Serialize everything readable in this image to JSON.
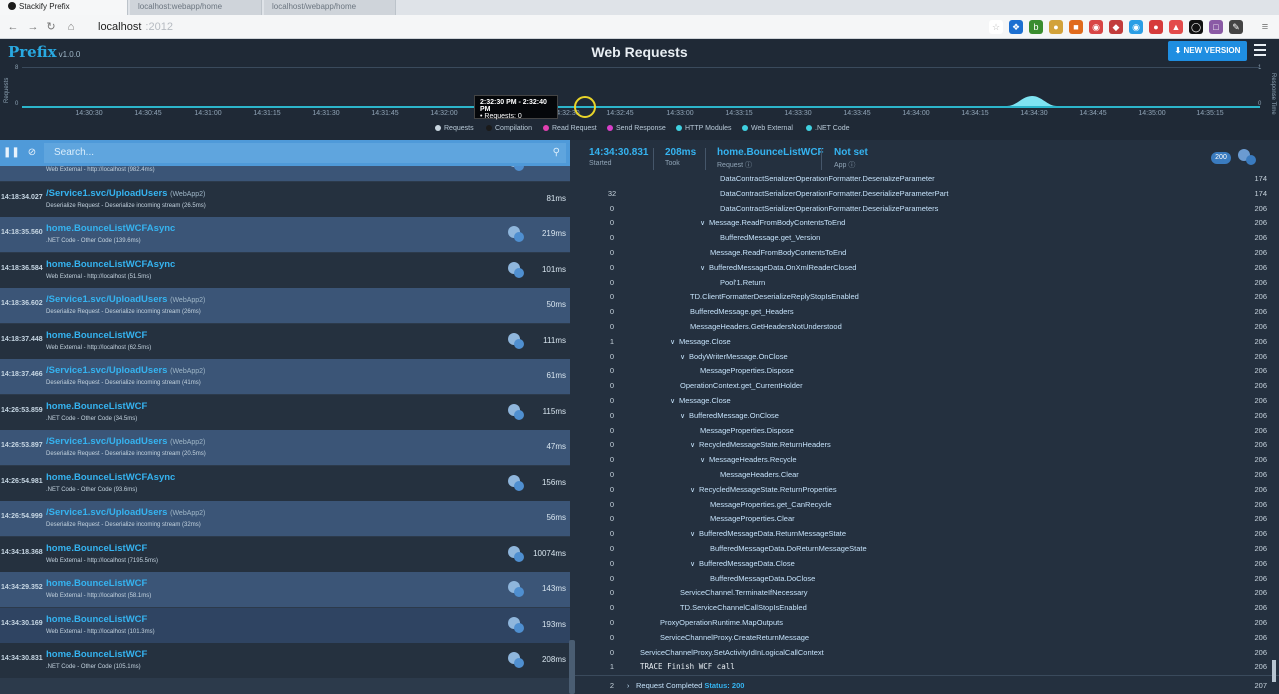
{
  "browser": {
    "tabs": [
      {
        "label": "Stackify Prefix",
        "active": true
      },
      {
        "label": "localhost:webapp/home",
        "active": false
      },
      {
        "label": "localhost/webapp/home",
        "active": false
      }
    ],
    "url": "localhost",
    "url_ghost": ":2012"
  },
  "app": {
    "logo": "Prefix",
    "version": "v1.0.0",
    "title": "Web Requests",
    "new_version_label": "NEW VERSION"
  },
  "timeline": {
    "left_axis_label": "Requests",
    "right_axis_label": "Response Time",
    "top_value": "8",
    "bottom_value": "0",
    "right_top": "1",
    "right_bottom": "0",
    "ticks": [
      "14:30:30",
      "14:30:45",
      "14:31:00",
      "14:31:15",
      "14:31:30",
      "14:31:45",
      "14:32:00",
      "14:32:30",
      "14:32:45",
      "14:33:00",
      "14:33:15",
      "14:33:30",
      "14:33:45",
      "14:34:00",
      "14:34:15",
      "14:34:30",
      "14:34:45",
      "14:35:00",
      "14:35:15"
    ],
    "tooltip_range": "2:32:30 PM - 2:32:40 PM",
    "tooltip_value": "• Requests: 0",
    "legend": [
      {
        "label": "Requests",
        "color": "#c9d6e0"
      },
      {
        "label": "Compilation",
        "color": "#1a1a1a"
      },
      {
        "label": "Read Request",
        "color": "#e040b0"
      },
      {
        "label": "Send Response",
        "color": "#d83fc9"
      },
      {
        "label": "HTTP Modules",
        "color": "#3fd0e0"
      },
      {
        "label": "Web External",
        "color": "#3fd0e0"
      },
      {
        "label": ".NET Code",
        "color": "#3fd0e0"
      }
    ]
  },
  "search": {
    "placeholder": "Search..."
  },
  "requests": [
    {
      "time": "",
      "name": "",
      "app": "",
      "sub": "Web External - http://localhost (982.4ms)",
      "dur": "",
      "badge": true,
      "style": "even"
    },
    {
      "time": "14:18:34.027",
      "name": "/Service1.svc/UploadUsers",
      "app": "(WebApp2)",
      "sub": "Deserialize Request - Deserialize incoming stream (26.5ms)",
      "dur": "81ms",
      "badge": false,
      "style": "dark"
    },
    {
      "time": "14:18:35.560",
      "name": "home.BounceListWCFAsync",
      "app": "",
      "sub": ".NET Code - Other Code (139.6ms)",
      "dur": "219ms",
      "badge": true,
      "style": "even"
    },
    {
      "time": "14:18:36.584",
      "name": "home.BounceListWCFAsync",
      "app": "",
      "sub": "Web External - http://localhost (51.5ms)",
      "dur": "101ms",
      "badge": true,
      "style": "dark"
    },
    {
      "time": "14:18:36.602",
      "name": "/Service1.svc/UploadUsers",
      "app": "(WebApp2)",
      "sub": "Deserialize Request - Deserialize incoming stream (26ms)",
      "dur": "50ms",
      "badge": false,
      "style": "even"
    },
    {
      "time": "14:18:37.448",
      "name": "home.BounceListWCF",
      "app": "",
      "sub": "Web External - http://localhost (62.5ms)",
      "dur": "111ms",
      "badge": true,
      "style": "dark"
    },
    {
      "time": "14:18:37.466",
      "name": "/Service1.svc/UploadUsers",
      "app": "(WebApp2)",
      "sub": "Deserialize Request - Deserialize incoming stream (41ms)",
      "dur": "61ms",
      "badge": false,
      "style": "even"
    },
    {
      "time": "14:26:53.859",
      "name": "home.BounceListWCF",
      "app": "",
      "sub": ".NET Code - Other Code (34.5ms)",
      "dur": "115ms",
      "badge": true,
      "style": "dark"
    },
    {
      "time": "14:26:53.897",
      "name": "/Service1.svc/UploadUsers",
      "app": "(WebApp2)",
      "sub": "Deserialize Request - Deserialize incoming stream (20.5ms)",
      "dur": "47ms",
      "badge": false,
      "style": "even"
    },
    {
      "time": "14:26:54.981",
      "name": "home.BounceListWCFAsync",
      "app": "",
      "sub": ".NET Code - Other Code (93.6ms)",
      "dur": "156ms",
      "badge": true,
      "style": "dark"
    },
    {
      "time": "14:26:54.999",
      "name": "/Service1.svc/UploadUsers",
      "app": "(WebApp2)",
      "sub": "Deserialize Request - Deserialize incoming stream (32ms)",
      "dur": "56ms",
      "badge": false,
      "style": "even"
    },
    {
      "time": "14:34:18.368",
      "name": "home.BounceListWCF",
      "app": "",
      "sub": "Web External - http://localhost (7195.5ms)",
      "dur": "10074ms",
      "badge": true,
      "style": "dark"
    },
    {
      "time": "14:34:29.352",
      "name": "home.BounceListWCF",
      "app": "",
      "sub": "Web External - http://localhost (58.1ms)",
      "dur": "143ms",
      "badge": true,
      "style": "even"
    },
    {
      "time": "14:34:30.169",
      "name": "home.BounceListWCF",
      "app": "",
      "sub": "Web External - http://localhost (101.3ms)",
      "dur": "193ms",
      "badge": true,
      "style": "odd"
    },
    {
      "time": "14:34:30.831",
      "name": "home.BounceListWCF",
      "app": "",
      "sub": ".NET Code - Other Code (105.1ms)",
      "dur": "208ms",
      "badge": true,
      "style": "dark"
    }
  ],
  "detail": {
    "started": "14:34:30.831",
    "started_label": "Started",
    "took": "208ms",
    "took_label": "Took",
    "request": "home.BounceListWCF",
    "request_label": "Request",
    "app": "Not set",
    "app_label": "App",
    "status_code": "200",
    "status_text": "Request Completed",
    "status_value": "Status: 200",
    "tree": [
      {
        "cnt": "",
        "indent": 13,
        "chev": false,
        "label": "DataContractSerializerOperationFormatter.DeserializeParameter",
        "ms": "174"
      },
      {
        "cnt": "32",
        "indent": 13,
        "chev": false,
        "label": "DataContractSerializerOperationFormatter.DeserializeParameterPart",
        "ms": "174"
      },
      {
        "cnt": "0",
        "indent": 13,
        "chev": false,
        "label": "DataContractSerializerOperationFormatter.DeserializeParameters",
        "ms": "206"
      },
      {
        "cnt": "0",
        "indent": 11,
        "chev": true,
        "label": "Message.ReadFromBodyContentsToEnd",
        "ms": "206"
      },
      {
        "cnt": "0",
        "indent": 13,
        "chev": false,
        "label": "BufferedMessage.get_Version",
        "ms": "206"
      },
      {
        "cnt": "0",
        "indent": 12,
        "chev": false,
        "label": "Message.ReadFromBodyContentsToEnd",
        "ms": "206"
      },
      {
        "cnt": "0",
        "indent": 11,
        "chev": true,
        "label": "BufferedMessageData.OnXmlReaderClosed",
        "ms": "206"
      },
      {
        "cnt": "0",
        "indent": 13,
        "chev": false,
        "label": "Pool'1.Return",
        "ms": "206"
      },
      {
        "cnt": "0",
        "indent": 10,
        "chev": false,
        "label": "TD.ClientFormatterDeserializeReplyStopIsEnabled",
        "ms": "206"
      },
      {
        "cnt": "0",
        "indent": 10,
        "chev": false,
        "label": "BufferedMessage.get_Headers",
        "ms": "206"
      },
      {
        "cnt": "0",
        "indent": 10,
        "chev": false,
        "label": "MessageHeaders.GetHeadersNotUnderstood",
        "ms": "206"
      },
      {
        "cnt": "1",
        "indent": 8,
        "chev": true,
        "label": "Message.Close",
        "ms": "206"
      },
      {
        "cnt": "0",
        "indent": 9,
        "chev": true,
        "label": "BodyWriterMessage.OnClose",
        "ms": "206"
      },
      {
        "cnt": "0",
        "indent": 11,
        "chev": false,
        "label": "MessageProperties.Dispose",
        "ms": "206"
      },
      {
        "cnt": "0",
        "indent": 9,
        "chev": false,
        "label": "OperationContext.get_CurrentHolder",
        "ms": "206"
      },
      {
        "cnt": "0",
        "indent": 8,
        "chev": true,
        "label": "Message.Close",
        "ms": "206"
      },
      {
        "cnt": "0",
        "indent": 9,
        "chev": true,
        "label": "BufferedMessage.OnClose",
        "ms": "206"
      },
      {
        "cnt": "0",
        "indent": 11,
        "chev": false,
        "label": "MessageProperties.Dispose",
        "ms": "206"
      },
      {
        "cnt": "0",
        "indent": 10,
        "chev": true,
        "label": "RecycledMessageState.ReturnHeaders",
        "ms": "206"
      },
      {
        "cnt": "0",
        "indent": 11,
        "chev": true,
        "label": "MessageHeaders.Recycle",
        "ms": "206"
      },
      {
        "cnt": "0",
        "indent": 13,
        "chev": false,
        "label": "MessageHeaders.Clear",
        "ms": "206"
      },
      {
        "cnt": "0",
        "indent": 10,
        "chev": true,
        "label": "RecycledMessageState.ReturnProperties",
        "ms": "206"
      },
      {
        "cnt": "0",
        "indent": 12,
        "chev": false,
        "label": "MessageProperties.get_CanRecycle",
        "ms": "206"
      },
      {
        "cnt": "0",
        "indent": 12,
        "chev": false,
        "label": "MessageProperties.Clear",
        "ms": "206"
      },
      {
        "cnt": "0",
        "indent": 10,
        "chev": true,
        "label": "BufferedMessageData.ReturnMessageState",
        "ms": "206"
      },
      {
        "cnt": "0",
        "indent": 12,
        "chev": false,
        "label": "BufferedMessageData.DoReturnMessageState",
        "ms": "206"
      },
      {
        "cnt": "0",
        "indent": 10,
        "chev": true,
        "label": "BufferedMessageData.Close",
        "ms": "206"
      },
      {
        "cnt": "0",
        "indent": 12,
        "chev": false,
        "label": "BufferedMessageData.DoClose",
        "ms": "206"
      },
      {
        "cnt": "0",
        "indent": 9,
        "chev": false,
        "label": "ServiceChannel.TerminateIfNecessary",
        "ms": "206"
      },
      {
        "cnt": "0",
        "indent": 9,
        "chev": false,
        "label": "TD.ServiceChannelCallStopIsEnabled",
        "ms": "206"
      },
      {
        "cnt": "0",
        "indent": 7,
        "chev": false,
        "label": "ProxyOperationRuntime.MapOutputs",
        "ms": "206"
      },
      {
        "cnt": "0",
        "indent": 7,
        "chev": false,
        "label": "ServiceChannelProxy.CreateReturnMessage",
        "ms": "206"
      },
      {
        "cnt": "0",
        "indent": 5,
        "chev": false,
        "label": "ServiceChannelProxy.SetActivityIdInLogicalCallContext",
        "ms": "206"
      },
      {
        "cnt": "1",
        "indent": 5,
        "chev": false,
        "label": "TRACE Finish WCF call",
        "ms": "206",
        "trace": true
      }
    ],
    "final_cnt": "2"
  },
  "colors": {
    "accent": "#29a9e1",
    "list_link": "#35b3f0",
    "button": "#1f8ee1"
  }
}
